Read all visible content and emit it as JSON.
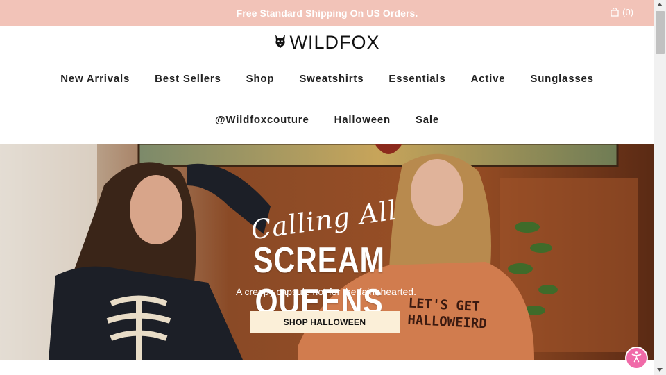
{
  "announcement": {
    "text": "Free Standard Shipping On US Orders."
  },
  "cart": {
    "count": "(0)",
    "icon": "shopping-bag-icon"
  },
  "logo": {
    "text": "WILDFOX",
    "icon": "fox-head-icon"
  },
  "nav": {
    "row1": [
      "New Arrivals",
      "Best Sellers",
      "Shop",
      "Sweatshirts",
      "Essentials",
      "Active",
      "Sunglasses"
    ],
    "row2": [
      "@Wildfoxcouture",
      "Halloween",
      "Sale"
    ]
  },
  "hero": {
    "script_line": "Calling All",
    "title": "SCREAM QUEENS",
    "subtitle": "A creepy capsule not for the faint-hearted.",
    "button_label": "SHOP HALLOWEEN",
    "sweater_text": "LET'S GET HALLOWEIRD"
  },
  "accessibility": {
    "icon": "accessibility-icon"
  },
  "colors": {
    "announce_bg": "#f2c3b8",
    "button_bg": "#fbefd8",
    "a11y_bg": "#f06aa8"
  }
}
